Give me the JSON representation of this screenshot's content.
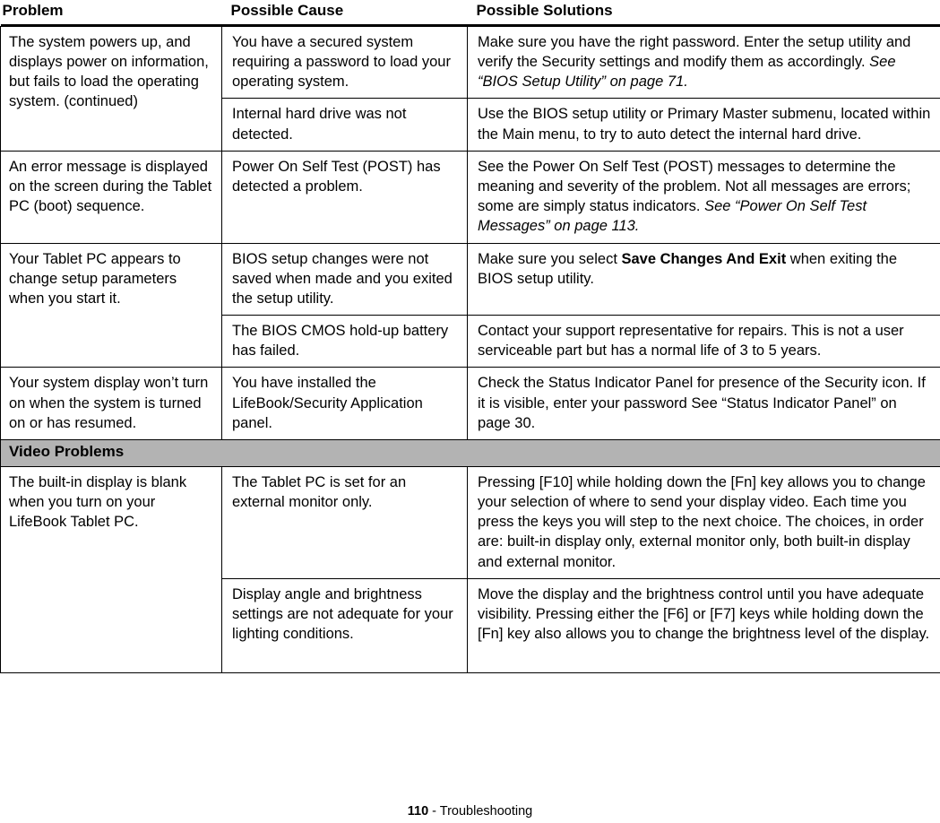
{
  "table": {
    "columns": [
      "Problem",
      "Possible Cause",
      "Possible Solutions"
    ],
    "rows": [
      {
        "problem": "The system powers up, and displays power on information, but fails to load the operating system. (continued)",
        "subrows": [
          {
            "cause": "You have a secured system requiring a password to load your operating system.",
            "solution_lead": "Make sure you have the right password. Enter the setup utility and verify the Security settings and modify them as accordingly. ",
            "solution_italic": "See “BIOS Setup Utility” on page 71.",
            "solution_tail": ""
          },
          {
            "cause": "Internal hard drive was not detected.",
            "solution_lead": "Use the BIOS setup utility or Primary Master submenu, located within the Main menu, to try to auto detect the internal hard drive.",
            "solution_italic": "",
            "solution_tail": ""
          }
        ]
      },
      {
        "problem": "An error message is displayed on the screen during the Tablet PC (boot) sequence.",
        "subrows": [
          {
            "cause": "Power On Self Test (POST) has detected a problem.",
            "solution_lead": "See the Power On Self Test (POST) messages to determine the meaning and severity of the problem. Not all messages are errors; some are simply status indicators. ",
            "solution_italic": "See “Power On Self Test Messages” on page 113.",
            "solution_tail": ""
          }
        ]
      },
      {
        "problem": "Your Tablet PC appears to change setup parameters when you start it.",
        "subrows": [
          {
            "cause": "BIOS setup changes were not saved when made and you exited the setup utility.",
            "solution_lead": "Make sure you select ",
            "solution_bold": "Save Changes And Exit",
            "solution_tail": " when exiting the BIOS setup utility."
          },
          {
            "cause": "The BIOS CMOS hold-up battery has failed.",
            "solution_lead": "Contact your support representative for repairs. This is not a user serviceable part but has a normal life of 3 to 5 years.",
            "solution_bold": "",
            "solution_tail": ""
          }
        ]
      },
      {
        "problem": "Your system display won’t turn on when the system is turned on or has resumed.",
        "subrows": [
          {
            "cause": "You have installed the LifeBook/Security Application panel.",
            "solution_lead": "Check the Status Indicator Panel for presence of the Security icon. If it is visible, enter your password See “Status Indicator Panel” on page 30.",
            "solution_italic": "",
            "solution_tail": ""
          }
        ]
      }
    ],
    "section_band": "Video Problems",
    "video_rows": [
      {
        "problem": "The built-in display is blank when you turn on your LifeBook Tablet PC.",
        "subrows": [
          {
            "cause": "The Tablet PC is set for an external monitor only.",
            "solution_lead": "Pressing [F10] while holding down the [Fn] key allows you to change your selection of where to send your display video. Each time you press the keys you will step to the next choice. The choices, in order are: built-in display only, external monitor only, both built-in display and external monitor.",
            "solution_italic": "",
            "solution_tail": ""
          },
          {
            "cause": "Display angle and brightness settings are not adequate for your lighting conditions.",
            "solution_lead": "Move the display and the brightness control until you have adequate visibility. Pressing either the [F6] or [F7] keys while holding down the [Fn] key also allows you to change the brightness level of the display.",
            "solution_italic": "",
            "solution_tail": ""
          }
        ]
      }
    ]
  },
  "footer": {
    "page_number": "110",
    "separator": " - ",
    "section_title": "Troubleshooting"
  },
  "colors": {
    "section_band_gray": "#b3b3b3",
    "rule": "#000000",
    "text": "#000000",
    "page_background": "#ffffff"
  }
}
